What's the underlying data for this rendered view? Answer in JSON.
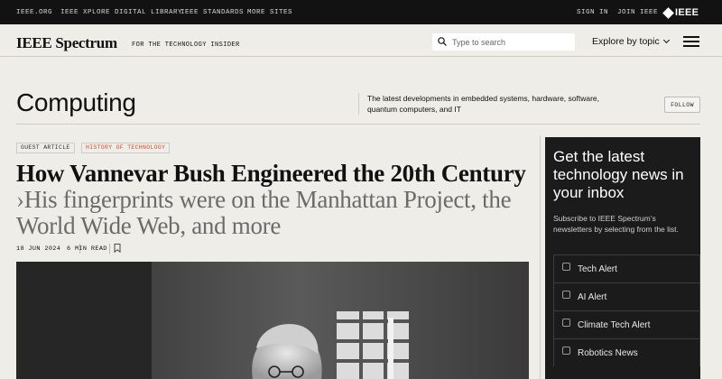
{
  "top_links": [
    "IEEE.ORG",
    "IEEE XPLORE DIGITAL LIBRARY",
    "IEEE STANDARDS",
    "MORE SITES"
  ],
  "top_right": {
    "sign_in": "SIGN IN",
    "join": "JOIN IEEE",
    "logo": "IEEE"
  },
  "header": {
    "brand": "IEEE Spectrum",
    "tagline": "FOR THE TECHNOLOGY INSIDER",
    "search_placeholder": "Type to search",
    "explore_label": "Explore by topic"
  },
  "section": {
    "title": "Computing",
    "description": "The latest developments in embedded systems, hardware, software, quantum computers, and IT",
    "follow_label": "FOLLOW"
  },
  "article": {
    "tags": [
      "GUEST ARTICLE",
      "HISTORY OF TECHNOLOGY"
    ],
    "title": "How Vannevar Bush Engineered the 20th Century",
    "separator": "›",
    "dek": "His fingerprints were on the Manhattan Project, the World Wide Web, and more",
    "date": "18 JUN 2024",
    "read_time": "6 MIN READ"
  },
  "newsletter": {
    "title": "Get the latest technology news in your inbox",
    "subtitle": "Subscribe to IEEE Spectrum’s newsletters by selecting from the list.",
    "options": [
      "Tech Alert",
      "AI Alert",
      "Climate Tech Alert",
      "Robotics News"
    ]
  },
  "colors": {
    "topbar_bg": "#121212",
    "page_bg": "#efede8",
    "accent_tag": "#d14b2c",
    "newsletter_bg": "#1b1b1b"
  },
  "icons": {
    "search": "search-icon",
    "chevron": "chevron-down-icon",
    "menu": "hamburger-icon",
    "bookmark": "bookmark-icon",
    "logo": "ieee-diamond-icon"
  }
}
